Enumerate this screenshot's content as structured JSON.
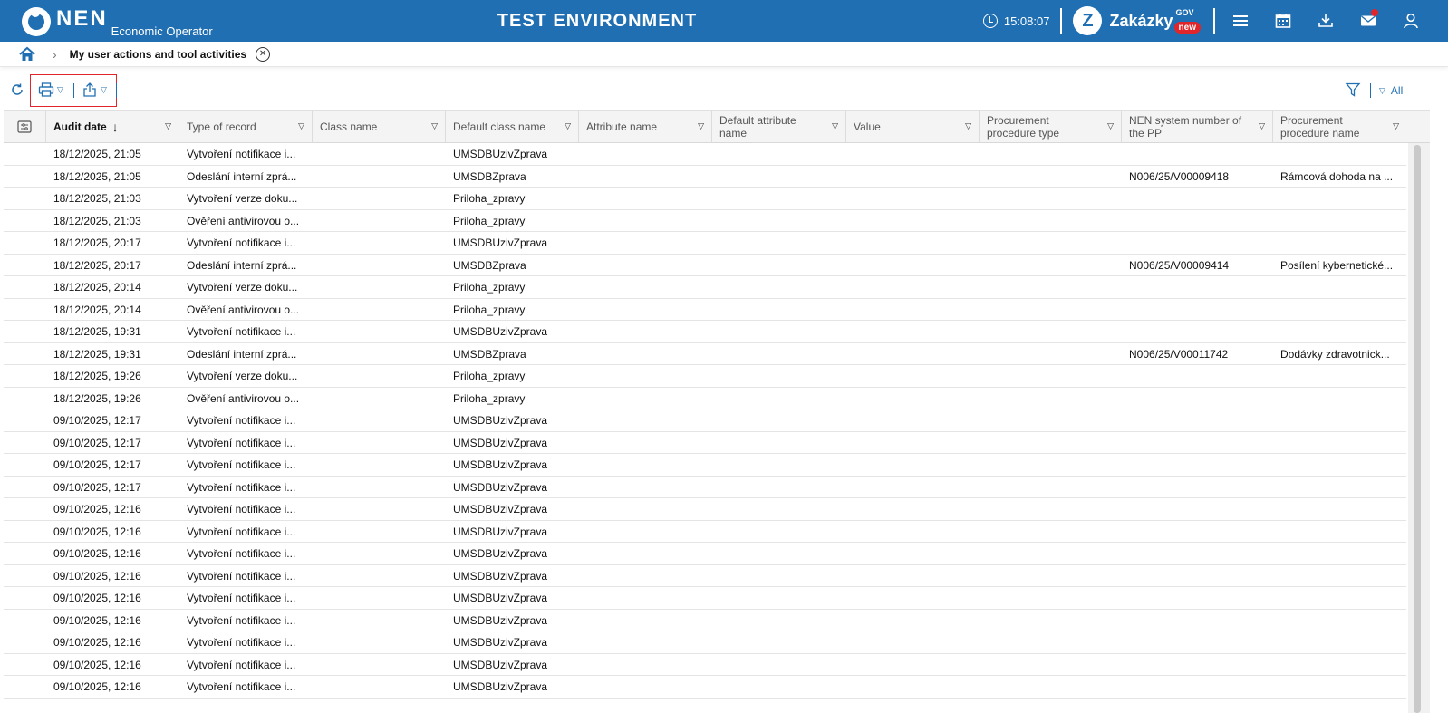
{
  "header": {
    "logo_text": "NEN",
    "logo_sub": "Economic Operator",
    "env_title": "TEST ENVIRONMENT",
    "time": "15:08:07",
    "brand_text": "Zakázky",
    "brand_gov": "GOV",
    "brand_new": "new",
    "icons": [
      "menu-icon",
      "calendar-icon",
      "download-icon",
      "mail-icon",
      "user-icon"
    ]
  },
  "breadcrumb": {
    "current": "My user actions and tool activities"
  },
  "toolbar": {
    "filter_label": "All"
  },
  "table": {
    "columns": [
      {
        "label": "Audit date",
        "sorted": "desc"
      },
      {
        "label": "Type of record"
      },
      {
        "label": "Class name"
      },
      {
        "label": "Default class name"
      },
      {
        "label": "Attribute name"
      },
      {
        "label": "Default attribute name"
      },
      {
        "label": "Value"
      },
      {
        "label": "Procurement procedure type"
      },
      {
        "label": "NEN system number of the PP"
      },
      {
        "label": "Procurement procedure name"
      }
    ],
    "rows": [
      {
        "date": "18/12/2025, 21:05",
        "type": "Vytvoření notifikace i...",
        "def_class": "UMSDBUzivZprava",
        "nen": "",
        "pp_name": ""
      },
      {
        "date": "18/12/2025, 21:05",
        "type": "Odeslání interní zprá...",
        "def_class": "UMSDBZprava",
        "nen": "N006/25/V00009418",
        "pp_name": "Rámcová dohoda na ..."
      },
      {
        "date": "18/12/2025, 21:03",
        "type": "Vytvoření verze doku...",
        "def_class": "Priloha_zpravy",
        "nen": "",
        "pp_name": ""
      },
      {
        "date": "18/12/2025, 21:03",
        "type": "Ověření antivirovou o...",
        "def_class": "Priloha_zpravy",
        "nen": "",
        "pp_name": ""
      },
      {
        "date": "18/12/2025, 20:17",
        "type": "Vytvoření notifikace i...",
        "def_class": "UMSDBUzivZprava",
        "nen": "",
        "pp_name": ""
      },
      {
        "date": "18/12/2025, 20:17",
        "type": "Odeslání interní zprá...",
        "def_class": "UMSDBZprava",
        "nen": "N006/25/V00009414",
        "pp_name": "Posílení kybernetické..."
      },
      {
        "date": "18/12/2025, 20:14",
        "type": "Vytvoření verze doku...",
        "def_class": "Priloha_zpravy",
        "nen": "",
        "pp_name": ""
      },
      {
        "date": "18/12/2025, 20:14",
        "type": "Ověření antivirovou o...",
        "def_class": "Priloha_zpravy",
        "nen": "",
        "pp_name": ""
      },
      {
        "date": "18/12/2025, 19:31",
        "type": "Vytvoření notifikace i...",
        "def_class": "UMSDBUzivZprava",
        "nen": "",
        "pp_name": ""
      },
      {
        "date": "18/12/2025, 19:31",
        "type": "Odeslání interní zprá...",
        "def_class": "UMSDBZprava",
        "nen": "N006/25/V00011742",
        "pp_name": "Dodávky zdravotnick..."
      },
      {
        "date": "18/12/2025, 19:26",
        "type": "Vytvoření verze doku...",
        "def_class": "Priloha_zpravy",
        "nen": "",
        "pp_name": ""
      },
      {
        "date": "18/12/2025, 19:26",
        "type": "Ověření antivirovou o...",
        "def_class": "Priloha_zpravy",
        "nen": "",
        "pp_name": ""
      },
      {
        "date": "09/10/2025, 12:17",
        "type": "Vytvoření notifikace i...",
        "def_class": "UMSDBUzivZprava",
        "nen": "",
        "pp_name": ""
      },
      {
        "date": "09/10/2025, 12:17",
        "type": "Vytvoření notifikace i...",
        "def_class": "UMSDBUzivZprava",
        "nen": "",
        "pp_name": ""
      },
      {
        "date": "09/10/2025, 12:17",
        "type": "Vytvoření notifikace i...",
        "def_class": "UMSDBUzivZprava",
        "nen": "",
        "pp_name": ""
      },
      {
        "date": "09/10/2025, 12:17",
        "type": "Vytvoření notifikace i...",
        "def_class": "UMSDBUzivZprava",
        "nen": "",
        "pp_name": ""
      },
      {
        "date": "09/10/2025, 12:16",
        "type": "Vytvoření notifikace i...",
        "def_class": "UMSDBUzivZprava",
        "nen": "",
        "pp_name": ""
      },
      {
        "date": "09/10/2025, 12:16",
        "type": "Vytvoření notifikace i...",
        "def_class": "UMSDBUzivZprava",
        "nen": "",
        "pp_name": ""
      },
      {
        "date": "09/10/2025, 12:16",
        "type": "Vytvoření notifikace i...",
        "def_class": "UMSDBUzivZprava",
        "nen": "",
        "pp_name": ""
      },
      {
        "date": "09/10/2025, 12:16",
        "type": "Vytvoření notifikace i...",
        "def_class": "UMSDBUzivZprava",
        "nen": "",
        "pp_name": ""
      },
      {
        "date": "09/10/2025, 12:16",
        "type": "Vytvoření notifikace i...",
        "def_class": "UMSDBUzivZprava",
        "nen": "",
        "pp_name": ""
      },
      {
        "date": "09/10/2025, 12:16",
        "type": "Vytvoření notifikace i...",
        "def_class": "UMSDBUzivZprava",
        "nen": "",
        "pp_name": ""
      },
      {
        "date": "09/10/2025, 12:16",
        "type": "Vytvoření notifikace i...",
        "def_class": "UMSDBUzivZprava",
        "nen": "",
        "pp_name": ""
      },
      {
        "date": "09/10/2025, 12:16",
        "type": "Vytvoření notifikace i...",
        "def_class": "UMSDBUzivZprava",
        "nen": "",
        "pp_name": ""
      },
      {
        "date": "09/10/2025, 12:16",
        "type": "Vytvoření notifikace i...",
        "def_class": "UMSDBUzivZprava",
        "nen": "",
        "pp_name": ""
      }
    ]
  },
  "colors": {
    "brand_blue": "#1f6fb2",
    "alert_red": "#e0262a"
  }
}
